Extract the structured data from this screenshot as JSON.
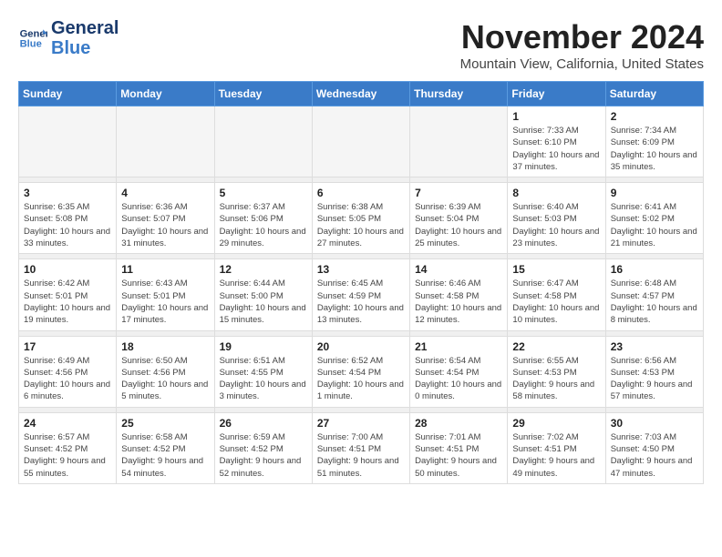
{
  "logo": {
    "general": "General",
    "blue": "Blue"
  },
  "title": "November 2024",
  "location": "Mountain View, California, United States",
  "weekdays": [
    "Sunday",
    "Monday",
    "Tuesday",
    "Wednesday",
    "Thursday",
    "Friday",
    "Saturday"
  ],
  "weeks": [
    [
      {
        "day": "",
        "info": ""
      },
      {
        "day": "",
        "info": ""
      },
      {
        "day": "",
        "info": ""
      },
      {
        "day": "",
        "info": ""
      },
      {
        "day": "",
        "info": ""
      },
      {
        "day": "1",
        "info": "Sunrise: 7:33 AM\nSunset: 6:10 PM\nDaylight: 10 hours and 37 minutes."
      },
      {
        "day": "2",
        "info": "Sunrise: 7:34 AM\nSunset: 6:09 PM\nDaylight: 10 hours and 35 minutes."
      }
    ],
    [
      {
        "day": "3",
        "info": "Sunrise: 6:35 AM\nSunset: 5:08 PM\nDaylight: 10 hours and 33 minutes."
      },
      {
        "day": "4",
        "info": "Sunrise: 6:36 AM\nSunset: 5:07 PM\nDaylight: 10 hours and 31 minutes."
      },
      {
        "day": "5",
        "info": "Sunrise: 6:37 AM\nSunset: 5:06 PM\nDaylight: 10 hours and 29 minutes."
      },
      {
        "day": "6",
        "info": "Sunrise: 6:38 AM\nSunset: 5:05 PM\nDaylight: 10 hours and 27 minutes."
      },
      {
        "day": "7",
        "info": "Sunrise: 6:39 AM\nSunset: 5:04 PM\nDaylight: 10 hours and 25 minutes."
      },
      {
        "day": "8",
        "info": "Sunrise: 6:40 AM\nSunset: 5:03 PM\nDaylight: 10 hours and 23 minutes."
      },
      {
        "day": "9",
        "info": "Sunrise: 6:41 AM\nSunset: 5:02 PM\nDaylight: 10 hours and 21 minutes."
      }
    ],
    [
      {
        "day": "10",
        "info": "Sunrise: 6:42 AM\nSunset: 5:01 PM\nDaylight: 10 hours and 19 minutes."
      },
      {
        "day": "11",
        "info": "Sunrise: 6:43 AM\nSunset: 5:01 PM\nDaylight: 10 hours and 17 minutes."
      },
      {
        "day": "12",
        "info": "Sunrise: 6:44 AM\nSunset: 5:00 PM\nDaylight: 10 hours and 15 minutes."
      },
      {
        "day": "13",
        "info": "Sunrise: 6:45 AM\nSunset: 4:59 PM\nDaylight: 10 hours and 13 minutes."
      },
      {
        "day": "14",
        "info": "Sunrise: 6:46 AM\nSunset: 4:58 PM\nDaylight: 10 hours and 12 minutes."
      },
      {
        "day": "15",
        "info": "Sunrise: 6:47 AM\nSunset: 4:58 PM\nDaylight: 10 hours and 10 minutes."
      },
      {
        "day": "16",
        "info": "Sunrise: 6:48 AM\nSunset: 4:57 PM\nDaylight: 10 hours and 8 minutes."
      }
    ],
    [
      {
        "day": "17",
        "info": "Sunrise: 6:49 AM\nSunset: 4:56 PM\nDaylight: 10 hours and 6 minutes."
      },
      {
        "day": "18",
        "info": "Sunrise: 6:50 AM\nSunset: 4:56 PM\nDaylight: 10 hours and 5 minutes."
      },
      {
        "day": "19",
        "info": "Sunrise: 6:51 AM\nSunset: 4:55 PM\nDaylight: 10 hours and 3 minutes."
      },
      {
        "day": "20",
        "info": "Sunrise: 6:52 AM\nSunset: 4:54 PM\nDaylight: 10 hours and 1 minute."
      },
      {
        "day": "21",
        "info": "Sunrise: 6:54 AM\nSunset: 4:54 PM\nDaylight: 10 hours and 0 minutes."
      },
      {
        "day": "22",
        "info": "Sunrise: 6:55 AM\nSunset: 4:53 PM\nDaylight: 9 hours and 58 minutes."
      },
      {
        "day": "23",
        "info": "Sunrise: 6:56 AM\nSunset: 4:53 PM\nDaylight: 9 hours and 57 minutes."
      }
    ],
    [
      {
        "day": "24",
        "info": "Sunrise: 6:57 AM\nSunset: 4:52 PM\nDaylight: 9 hours and 55 minutes."
      },
      {
        "day": "25",
        "info": "Sunrise: 6:58 AM\nSunset: 4:52 PM\nDaylight: 9 hours and 54 minutes."
      },
      {
        "day": "26",
        "info": "Sunrise: 6:59 AM\nSunset: 4:52 PM\nDaylight: 9 hours and 52 minutes."
      },
      {
        "day": "27",
        "info": "Sunrise: 7:00 AM\nSunset: 4:51 PM\nDaylight: 9 hours and 51 minutes."
      },
      {
        "day": "28",
        "info": "Sunrise: 7:01 AM\nSunset: 4:51 PM\nDaylight: 9 hours and 50 minutes."
      },
      {
        "day": "29",
        "info": "Sunrise: 7:02 AM\nSunset: 4:51 PM\nDaylight: 9 hours and 49 minutes."
      },
      {
        "day": "30",
        "info": "Sunrise: 7:03 AM\nSunset: 4:50 PM\nDaylight: 9 hours and 47 minutes."
      }
    ]
  ]
}
